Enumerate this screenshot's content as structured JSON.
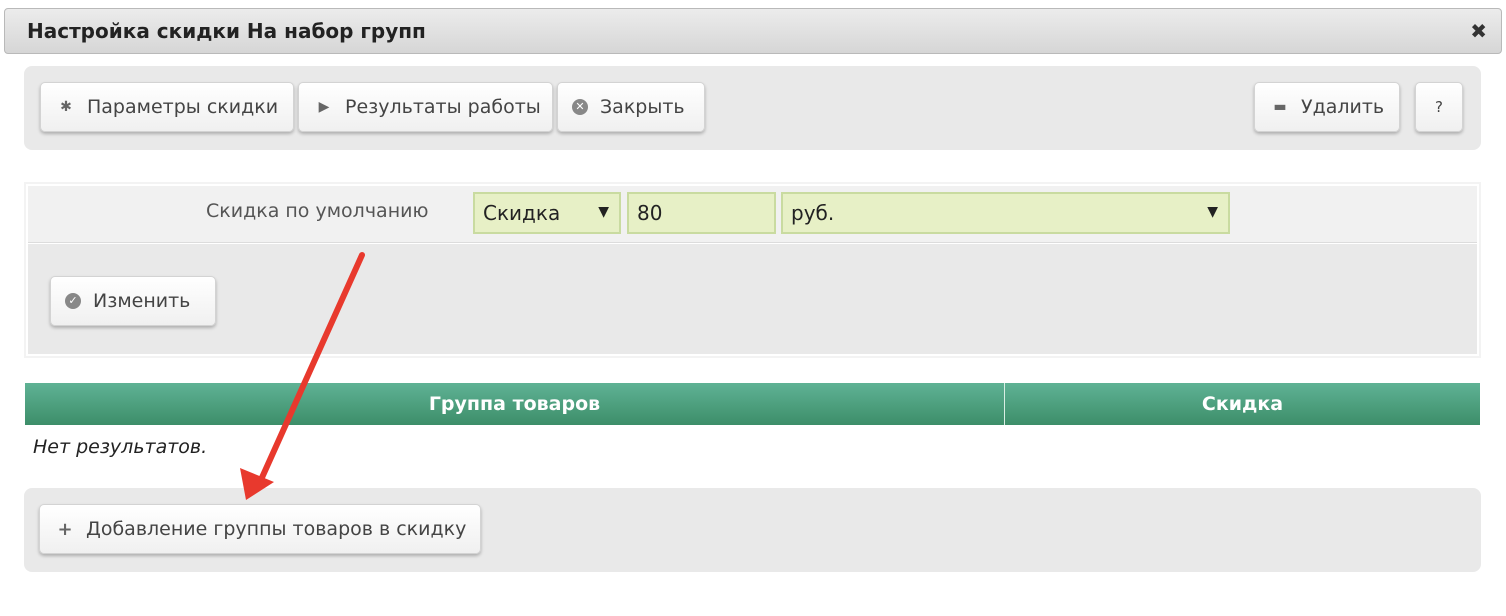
{
  "dialog": {
    "title": "Настройка скидки На набор групп",
    "close_glyph": "✖"
  },
  "toolbar": {
    "params_label": "Параметры скидки",
    "params_icon": "gear-icon",
    "results_label": "Результаты работы",
    "results_icon": "play-icon",
    "close_label": "Закрыть",
    "close_icon": "close-circle-icon",
    "delete_label": "Удалить",
    "delete_icon": "minus-icon",
    "help_label": "?"
  },
  "default_discount": {
    "label": "Скидка по умолчанию",
    "type_value": "Скидка",
    "amount_value": "80",
    "currency_value": "руб."
  },
  "edit": {
    "label": "Изменить",
    "icon": "check-circle-icon"
  },
  "grid": {
    "columns": [
      "Группа товаров",
      "Скидка"
    ],
    "empty_text": "Нет результатов."
  },
  "bottom": {
    "add_group_label": "Добавление группы товаров в скидку",
    "add_icon": "plus-icon"
  },
  "colors": {
    "header_green": "#4a9f7b",
    "field_bg": "#e7f0c6",
    "arrow_red": "#e8392d"
  }
}
